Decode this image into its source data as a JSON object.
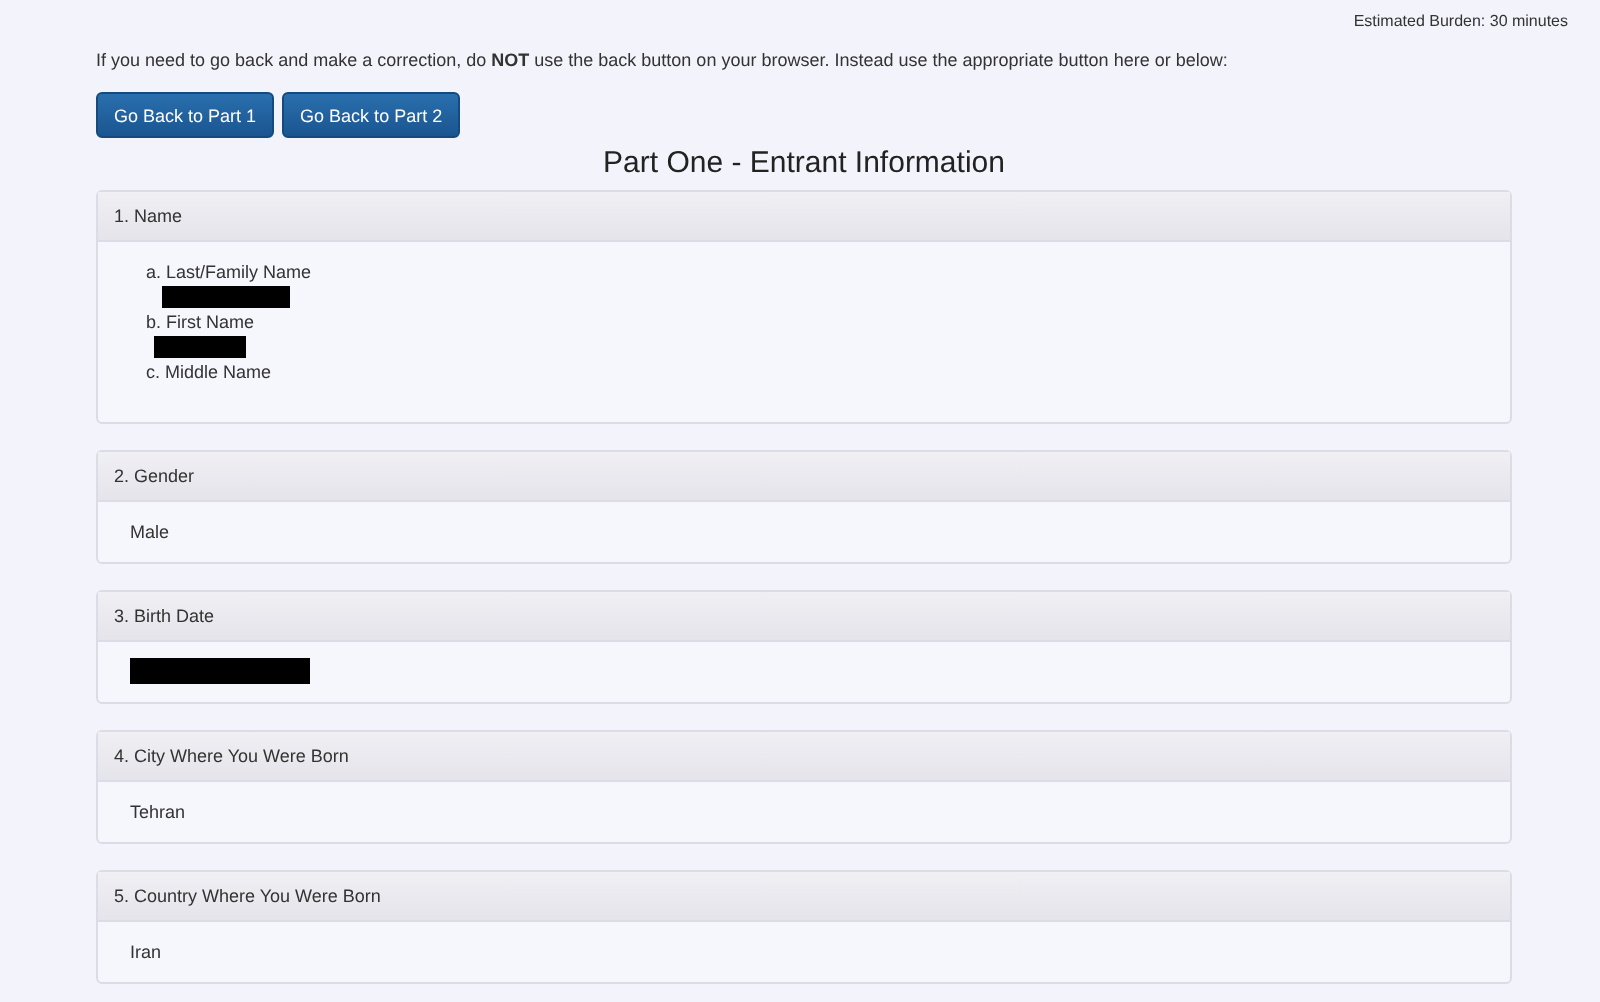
{
  "burden": "Estimated Burden: 30 minutes",
  "notice": "If you need to go back and make a correction, do **NOT** use the back button on your browser. Instead use the appropriate button here or below:",
  "buttons": [
    "Go Back to Part 1",
    "Go Back to Part 2"
  ],
  "title": "Part One - Entrant Information",
  "panels": [
    {
      "heading": "1. Name",
      "kind": "fields",
      "fields": [
        {
          "label": "a. Last/Family Name",
          "redacted": true
        },
        {
          "label": "b. First Name",
          "redacted": true
        },
        {
          "label": "c. Middle Name",
          "redacted": false
        }
      ]
    },
    {
      "heading": "2. Gender",
      "kind": "value",
      "value": "Male"
    },
    {
      "heading": "3. Birth Date",
      "kind": "redacted"
    },
    {
      "heading": "4. City Where You Were Born",
      "kind": "value",
      "value": "Tehran"
    },
    {
      "heading": "5. Country Where You Were Born",
      "kind": "value",
      "value": "Iran"
    }
  ]
}
